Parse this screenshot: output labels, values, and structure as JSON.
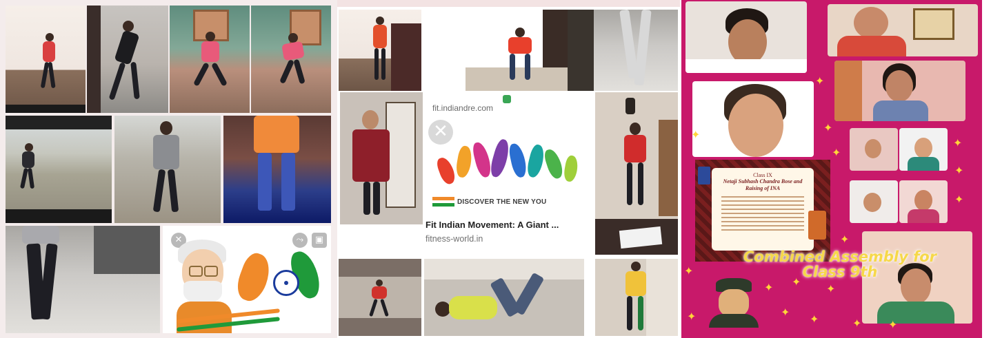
{
  "panel2": {
    "card": {
      "url_fragment": "fit.indiandre.com",
      "banner_text": "DISCOVER THE NEW YOU",
      "title": "Fit Indian Movement: A Giant ...",
      "site": "fitness-world.in"
    }
  },
  "panel3": {
    "poster": {
      "class_label": "Class IX",
      "title": "Netaji Subhash Chandra Bose and Raising of INA"
    },
    "banner_text_line1": "Combined Assembly for",
    "banner_text_line2": "Class 9th"
  },
  "colors": {
    "collage_background": "#c8196a",
    "banner_text": "#f6d84a",
    "star": "#ffd53a"
  },
  "icons": [
    "close-icon",
    "share-icon",
    "star-icon",
    "flag-icon"
  ]
}
